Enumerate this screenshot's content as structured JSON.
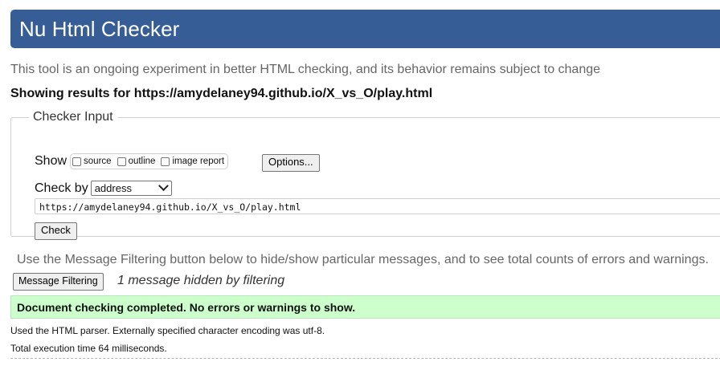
{
  "header": {
    "title": "Nu Html Checker"
  },
  "subtitle": "This tool is an ongoing experiment in better HTML checking, and its behavior remains subject to change",
  "results_heading": "Showing results for https://amydelaney94.github.io/X_vs_O/play.html",
  "checker_input": {
    "legend": "Checker Input",
    "show_label": "Show",
    "show_options": [
      {
        "label": "source",
        "checked": false
      },
      {
        "label": "outline",
        "checked": false
      },
      {
        "label": "image report",
        "checked": false
      }
    ],
    "options_button": "Options...",
    "check_by_label": "Check by",
    "check_by_value": "address",
    "url_value": "https://amydelaney94.github.io/X_vs_O/play.html",
    "check_button": "Check"
  },
  "filtering": {
    "note": "Use the Message Filtering button below to hide/show particular messages, and to see total counts of errors and warnings.",
    "button": "Message Filtering",
    "hidden_count": "1 message hidden by filtering"
  },
  "result": {
    "success_message": "Document checking completed. No errors or warnings to show.",
    "parser_note": "Used the HTML parser. Externally specified character encoding was utf-8.",
    "execution_time": "Total execution time 64 milliseconds."
  },
  "colors": {
    "header_bg": "#365d95",
    "success_bg": "#ccffcc"
  }
}
